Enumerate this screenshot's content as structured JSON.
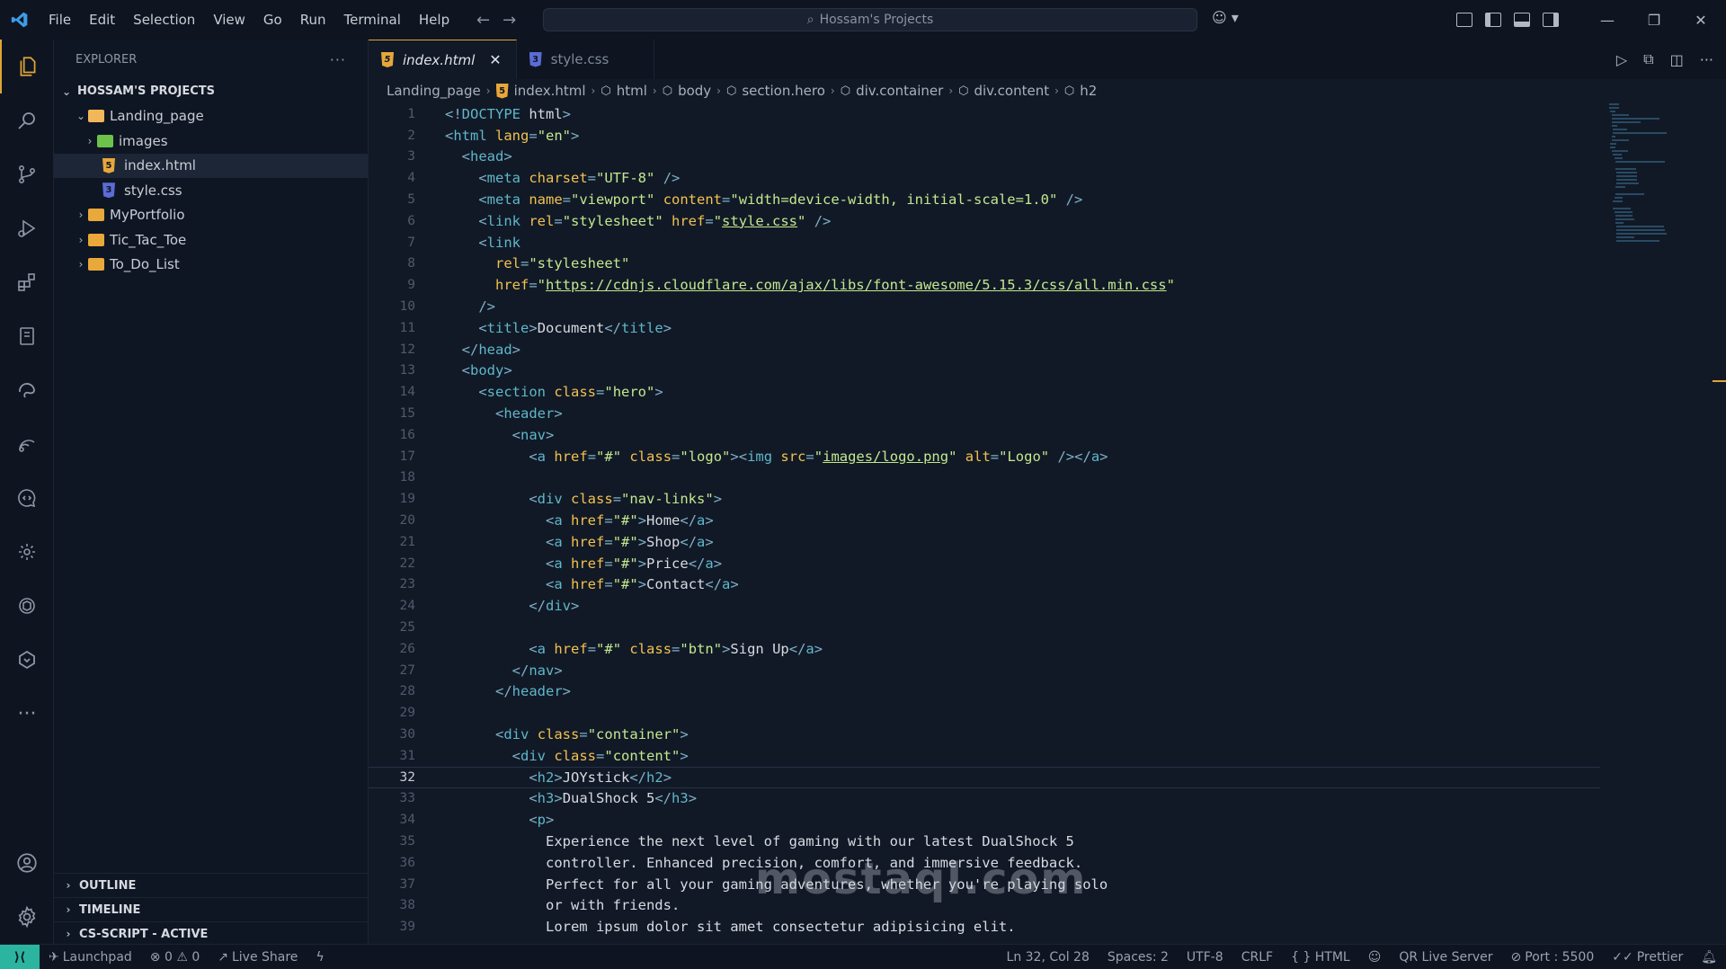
{
  "titlebar": {
    "menu": [
      "File",
      "Edit",
      "Selection",
      "View",
      "Go",
      "Run",
      "Terminal",
      "Help"
    ],
    "search_text": "Hossam's Projects",
    "window_controls": [
      "—",
      "❐",
      "✕"
    ]
  },
  "sidebar": {
    "title": "EXPLORER",
    "more": "···",
    "root": "HOSSAM'S PROJECTS",
    "tree": [
      {
        "label": "Landing_page",
        "level": 1,
        "type": "folder-open"
      },
      {
        "label": "images",
        "level": 2,
        "type": "folder-img"
      },
      {
        "label": "index.html",
        "level": 2,
        "type": "html",
        "selected": true
      },
      {
        "label": "style.css",
        "level": 2,
        "type": "css"
      },
      {
        "label": "MyPortfolio",
        "level": 1,
        "type": "folder"
      },
      {
        "label": "Tic_Tac_Toe",
        "level": 1,
        "type": "folder"
      },
      {
        "label": "To_Do_List",
        "level": 1,
        "type": "folder"
      }
    ],
    "panels": [
      "OUTLINE",
      "TIMELINE",
      "CS-SCRIPT - ACTIVE"
    ]
  },
  "tabs": [
    {
      "label": "index.html",
      "active": true,
      "type": "html"
    },
    {
      "label": "style.css",
      "active": false,
      "type": "css"
    }
  ],
  "breadcrumb": [
    "Landing_page",
    "index.html",
    "html",
    "body",
    "section.hero",
    "div.container",
    "div.content",
    "h2"
  ],
  "code": {
    "current_line": 32,
    "lines": [
      "<!DOCTYPE html>",
      "<html lang=\"en\">",
      "  <head>",
      "    <meta charset=\"UTF-8\" />",
      "    <meta name=\"viewport\" content=\"width=device-width, initial-scale=1.0\" />",
      "    <link rel=\"stylesheet\" href=\"style.css\" />",
      "    <link",
      "      rel=\"stylesheet\"",
      "      href=\"https://cdnjs.cloudflare.com/ajax/libs/font-awesome/5.15.3/css/all.min.css\"",
      "    />",
      "    <title>Document</title>",
      "  </head>",
      "  <body>",
      "    <section class=\"hero\">",
      "      <header>",
      "        <nav>",
      "          <a href=\"#\" class=\"logo\"><img src=\"images/logo.png\" alt=\"Logo\" /></a>",
      "",
      "          <div class=\"nav-links\">",
      "            <a href=\"#\">Home</a>",
      "            <a href=\"#\">Shop</a>",
      "            <a href=\"#\">Price</a>",
      "            <a href=\"#\">Contact</a>",
      "          </div>",
      "",
      "          <a href=\"#\" class=\"btn\">Sign Up</a>",
      "        </nav>",
      "      </header>",
      "",
      "      <div class=\"container\">",
      "        <div class=\"content\">",
      "          <h2>JOYstick</h2>",
      "          <h3>DualShock 5</h3>",
      "          <p>",
      "            Experience the next level of gaming with our latest DualShock 5",
      "            controller. Enhanced precision, comfort, and immersive feedback.",
      "            Perfect for all your gaming adventures, whether you're playing solo",
      "            or with friends.",
      "            Lorem ipsum dolor sit amet consectetur adipisicing elit."
    ]
  },
  "statusbar": {
    "left": [
      "Launchpad",
      "⊗ 0 ⚠ 0",
      "Live Share"
    ],
    "right": [
      "Ln 32, Col 28",
      "Spaces: 2",
      "UTF-8",
      "CRLF",
      "{ } HTML",
      "QR Live Server",
      "Port : 5500",
      "Prettier"
    ]
  },
  "watermark": "mostaql.com",
  "colors": {
    "tag": "#5fb7c9",
    "attr": "#f2c14e",
    "string": "#c3e88d",
    "punct": "#7fb0c6",
    "accent": "#e0a437"
  }
}
